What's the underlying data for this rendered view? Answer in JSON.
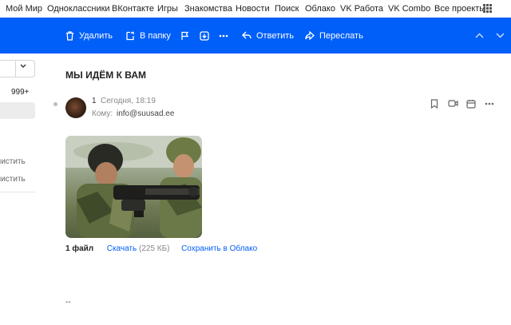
{
  "portal": {
    "links": [
      "Мой Мир",
      "Одноклассники",
      "ВКонтакте",
      "Игры",
      "Знакомства",
      "Новости",
      "Поиск",
      "Облако",
      "VK Работа",
      "VK Combo",
      "Все проекты"
    ]
  },
  "toolbar": {
    "delete_label": "Удалить",
    "move_label": "В папку",
    "reply_label": "Ответить",
    "forward_label": "Переслать"
  },
  "sidebar": {
    "unread_count": "999+",
    "clean_1": "чистить",
    "clean_2": "чистить"
  },
  "message": {
    "subject": "МЫ ИДЁМ К ВАМ",
    "sender": "1",
    "date": "Сегодня, 18:19",
    "to_label": "Кому:",
    "to_address": "info@suusad.ee",
    "signature": "--"
  },
  "attachments": {
    "count_label": "1 файл",
    "download_label": "Скачать",
    "download_size": "(225 КБ)",
    "save_cloud_label": "Сохранить в Облако"
  },
  "colors": {
    "accent": "#005ff9",
    "toolbar_text": "#ffffff"
  }
}
